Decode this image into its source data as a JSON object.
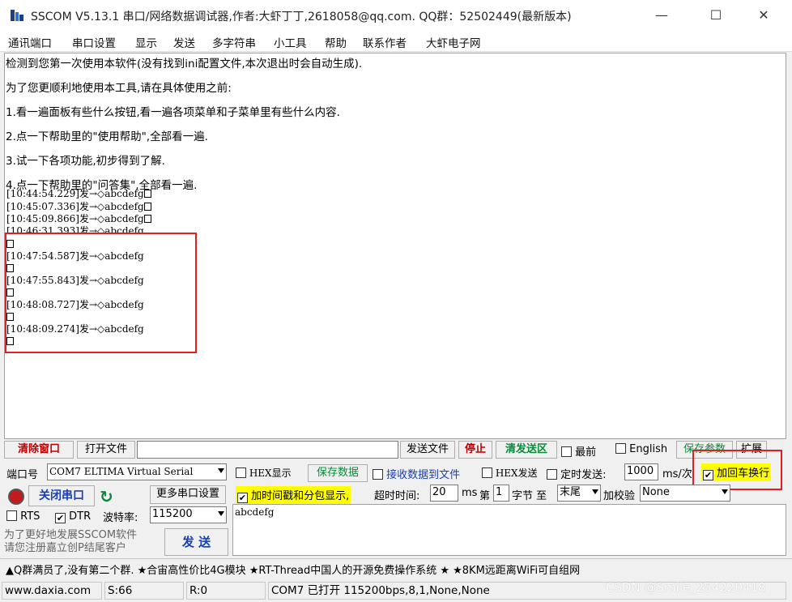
{
  "window": {
    "title": "SSCOM V5.13.1 串口/网络数据调试器,作者:大虾丁丁,2618058@qq.com. QQ群：52502449(最新版本)",
    "minimize": "—",
    "maximize": "☐",
    "close": "✕"
  },
  "menu": [
    "通讯端口",
    "串口设置",
    "显示",
    "发送",
    "多字符串",
    "小工具",
    "帮助",
    "联系作者",
    "大虾电子网"
  ],
  "receive": {
    "notes": [
      "检测到您第一次使用本软件(没有找到ini配置文件,本次退出时会自动生成).",
      "为了您更顺利地使用本工具,请在具体使用之前:",
      "1.看一遍面板有些什么按钮,看一遍各项菜单和子菜单里有些什么内容.",
      "2.点一下帮助里的\"使用帮助\",全部看一遍.",
      "3.试一下各项功能,初步得到了解.",
      "4.点一下帮助里的\"问答集\",全部看一遍."
    ],
    "log_inline": [
      "[10:44:54.229]发→◇abcdefg",
      "[10:45:07.336]发→◇abcdefg",
      "[10:45:09.866]发→◇abcdefg",
      "[10:46:31.393]发→◇abcdefg"
    ],
    "log_newline": [
      "[10:47:54.587]发→◇abcdefg",
      "[10:47:55.843]发→◇abcdefg",
      "[10:48:08.727]发→◇abcdefg",
      "[10:48:09.274]发→◇abcdefg"
    ]
  },
  "toolbar": {
    "clear_window": "清除窗口",
    "open_file": "打开文件",
    "file_path": "",
    "send_file": "发送文件",
    "stop": "停止",
    "clear_send": "清发送区",
    "topmost": "最前",
    "english": "English",
    "save_params": "保存参数",
    "expand": "扩展"
  },
  "port": {
    "port_label": "端口号",
    "port_value": "COM7 ELTIMA Virtual Serial",
    "close_port": "关闭串口",
    "more_settings": "更多串口设置",
    "rts": "RTS",
    "dtr": "DTR",
    "baud_label": "波特率:",
    "baud_value": "115200",
    "promo": "为了更好地发展SSCOM软件\n请您注册嘉立创P结尾客户",
    "send": "发 送"
  },
  "options": {
    "hex_display": "HEX显示",
    "save_data": "保存数据",
    "recv_to_file": "接收数据到文件",
    "hex_send": "HEX发送",
    "timed_send": "定时发送:",
    "interval": "1000",
    "interval_unit": "ms/次",
    "add_crlf": "加回车换行",
    "timestamp": "加时间戳和分包显示,",
    "timeout_label": "超时时间:",
    "timeout_value": "20",
    "timeout_unit": "ms",
    "byte_prefix": "第",
    "byte_index": "1",
    "byte_suffix": "字节 至",
    "byte_end": "末尾",
    "checksum_label": "加校验",
    "checksum_value": "None"
  },
  "send_text": "abcdefg",
  "ad_text": "▲Q群满员了,没有第二个群. ★合宙高性价比4G模块 ★RT-Thread中国人的开源免费操作系统 ★ ★8KM远距离WiFi可自组网",
  "status": {
    "site": "www.daxia.com",
    "sent": "S:66",
    "recv": "R:0",
    "port_state": "COM7 已打开  115200bps,8,1,None,None"
  },
  "watermark": "CSDN @Smile_254220418",
  "colors": {
    "highlight_box": "#e02020",
    "label_yellow": "#ffff00",
    "clear_red": "#c00000",
    "action_green": "#0a8a3a"
  }
}
